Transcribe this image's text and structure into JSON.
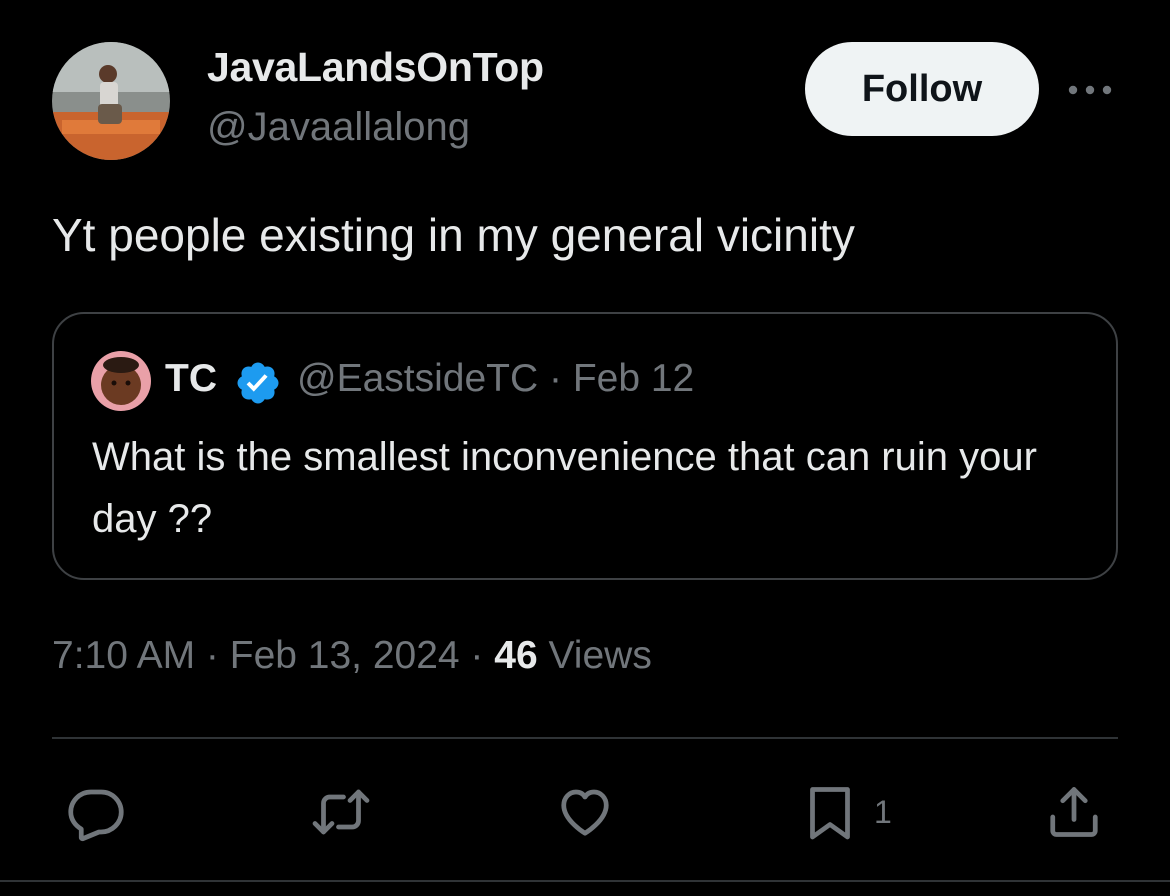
{
  "author": {
    "display_name": "JavaLandsOnTop",
    "handle": "@Javaallalong"
  },
  "header": {
    "follow_label": "Follow",
    "more_icon": "more-horizontal-icon"
  },
  "tweet": {
    "text": "Yt people existing in my general vicinity"
  },
  "quoted_tweet": {
    "display_name": "TC",
    "verified": true,
    "meta": "@EastsideTC · Feb 12",
    "text": "What is the smallest inconvenience that can ruin your day ??"
  },
  "meta": {
    "timestamp": "7:10 AM · Feb 13, 2024 · ",
    "views_count": "46",
    "views_label": " Views"
  },
  "actions": {
    "reply_icon": "reply-icon",
    "retweet_icon": "retweet-icon",
    "like_icon": "heart-icon",
    "bookmark_icon": "bookmark-icon",
    "bookmark_count": "1",
    "share_icon": "share-icon"
  },
  "colors": {
    "background": "#000000",
    "text_primary": "#e7e9ea",
    "text_secondary": "#71767b",
    "border": "#2f3336",
    "verified_blue": "#1d9bf0",
    "follow_button_bg": "#eff3f4"
  }
}
